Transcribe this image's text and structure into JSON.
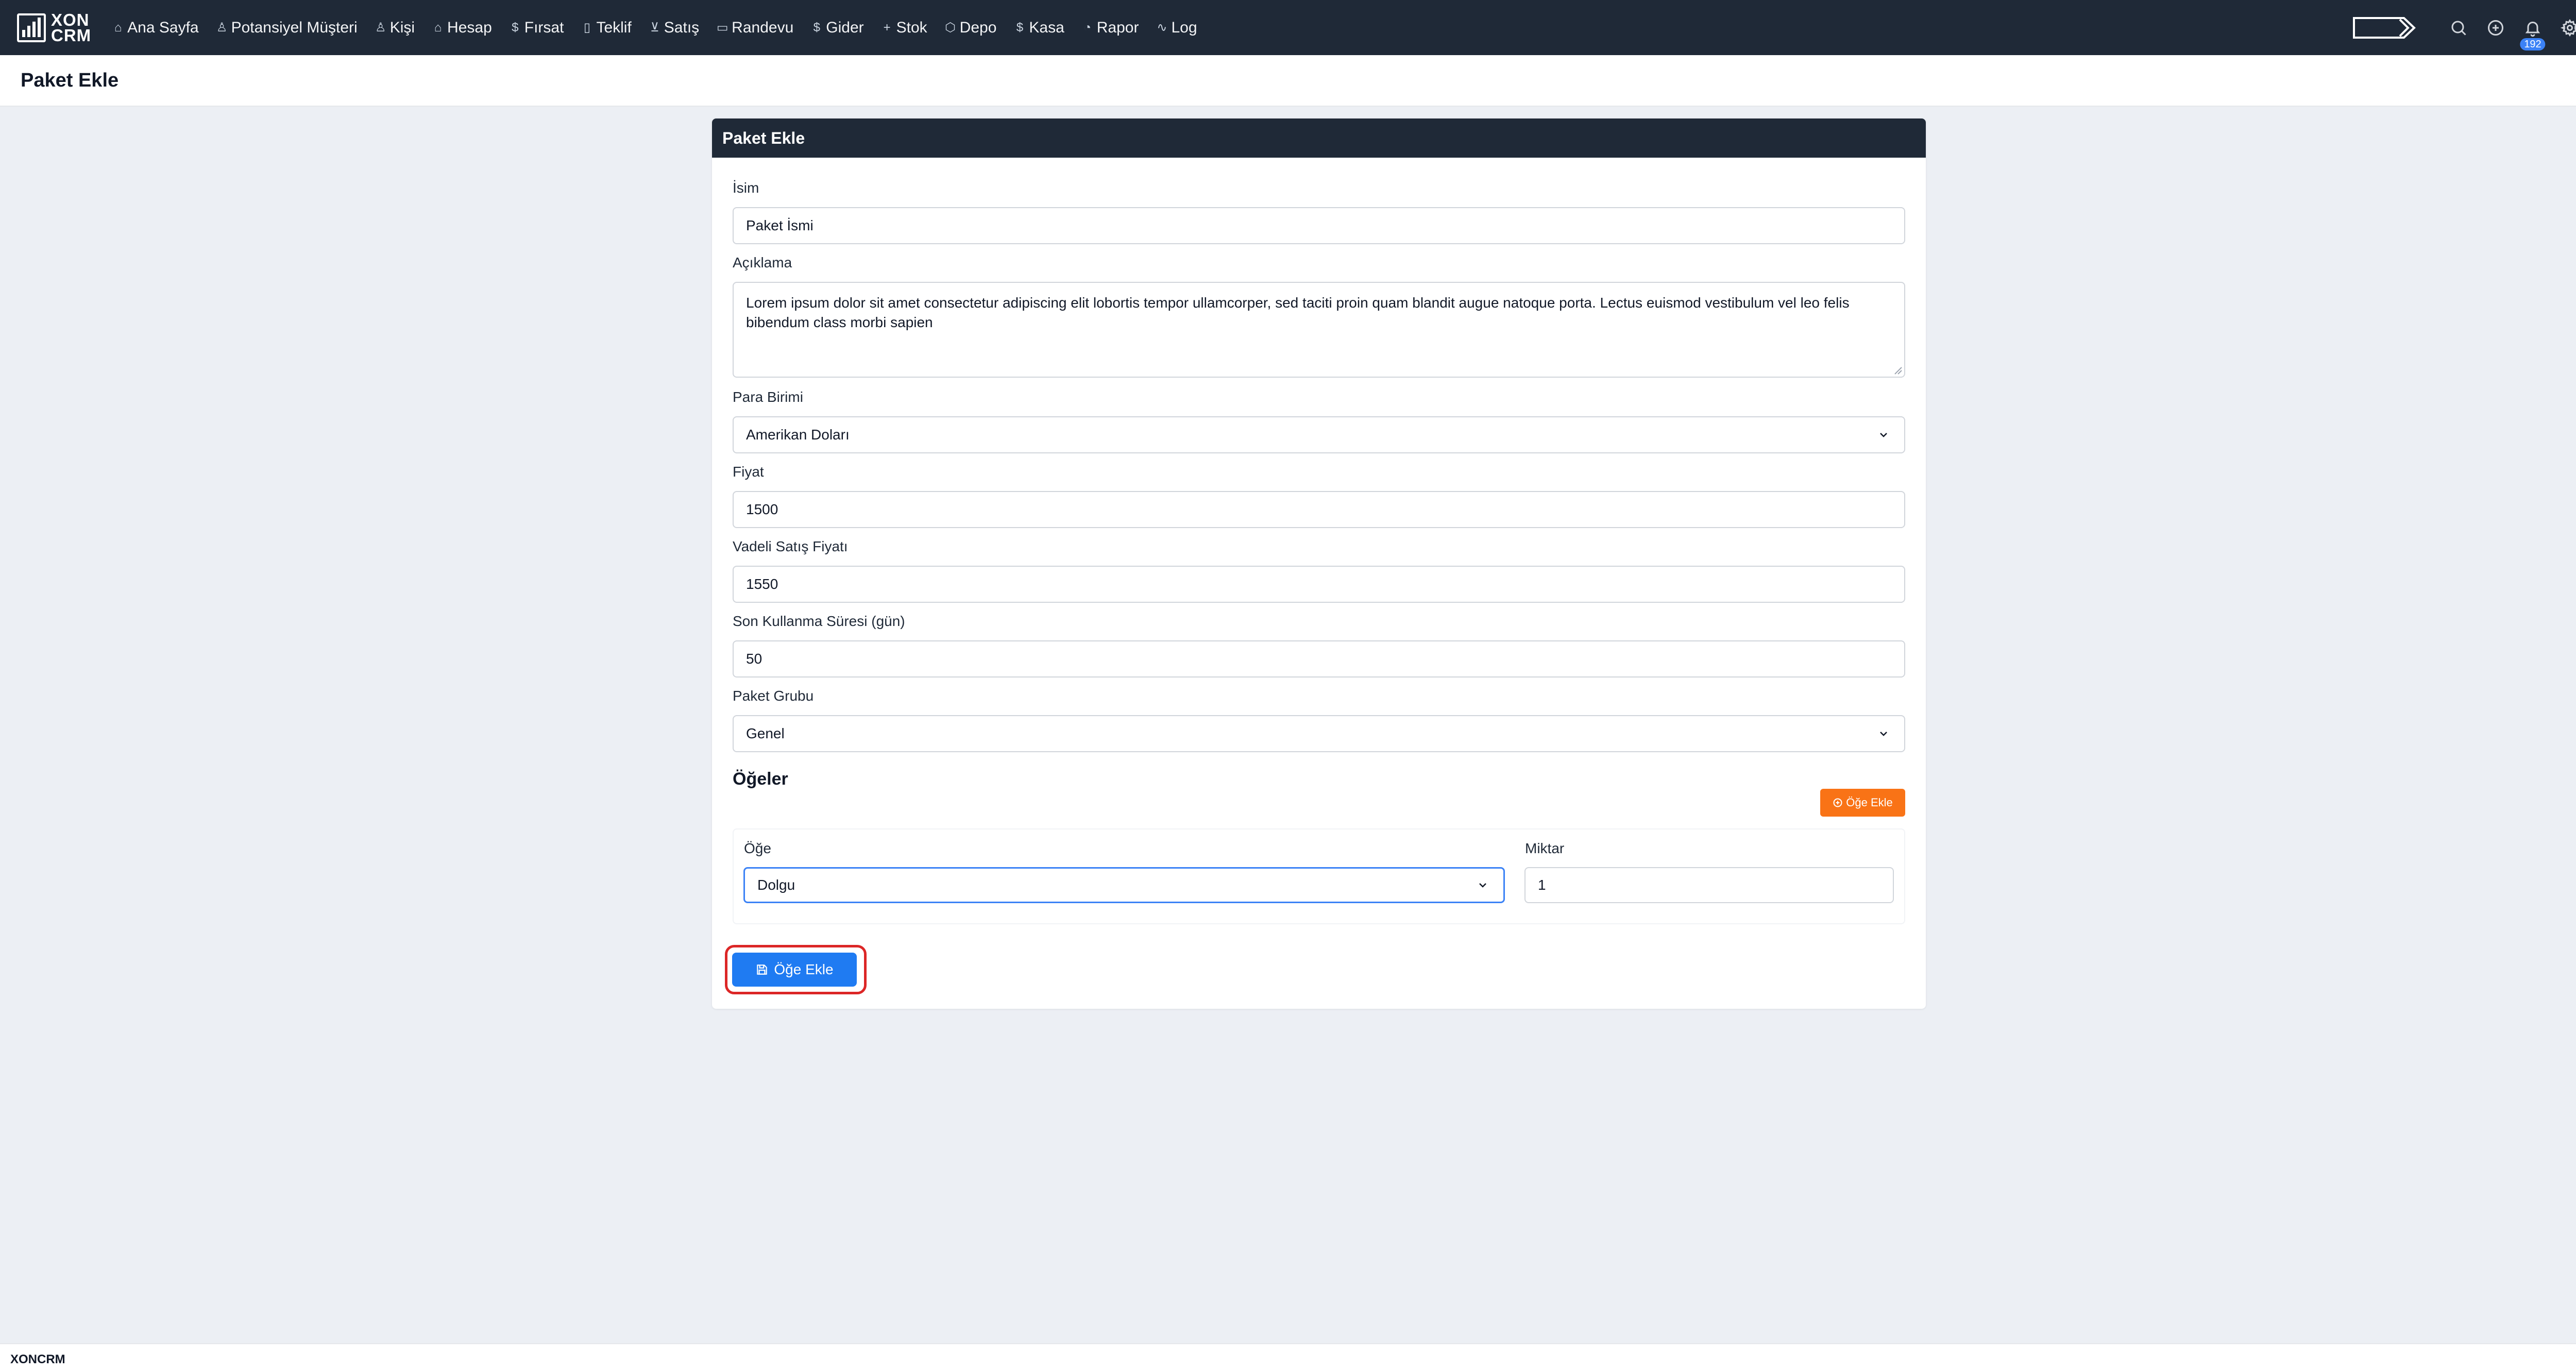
{
  "app": {
    "logo_line1": "XON",
    "logo_line2": "CRM"
  },
  "nav": {
    "items": [
      {
        "label": "Ana Sayfa",
        "icon": "home-icon",
        "glyph": "⌂"
      },
      {
        "label": "Potansiyel Müşteri",
        "icon": "user-icon",
        "glyph": "♙"
      },
      {
        "label": "Kişi",
        "icon": "users-icon",
        "glyph": "♙"
      },
      {
        "label": "Hesap",
        "icon": "home-icon",
        "glyph": "⌂"
      },
      {
        "label": "Fırsat",
        "icon": "dollar-icon",
        "glyph": "$"
      },
      {
        "label": "Teklif",
        "icon": "document-icon",
        "glyph": "▯"
      },
      {
        "label": "Satış",
        "icon": "cart-icon",
        "glyph": "⊻"
      },
      {
        "label": "Randevu",
        "icon": "calendar-icon",
        "glyph": "▭"
      },
      {
        "label": "Gider",
        "icon": "dollar-icon",
        "glyph": "$"
      },
      {
        "label": "Stok",
        "icon": "plus-icon",
        "glyph": "+"
      },
      {
        "label": "Depo",
        "icon": "cube-icon",
        "glyph": "⬡"
      },
      {
        "label": "Kasa",
        "icon": "dollar-icon",
        "glyph": "$"
      },
      {
        "label": "Rapor",
        "icon": "pie-chart-icon",
        "glyph": "◔"
      },
      {
        "label": "Log",
        "icon": "activity-icon",
        "glyph": "∿"
      }
    ],
    "notifications_count": "192"
  },
  "page": {
    "title": "Paket Ekle"
  },
  "form": {
    "card_title": "Paket Ekle",
    "name_label": "İsim",
    "name_value": "Paket İsmi",
    "description_label": "Açıklama",
    "description_value": "Lorem ipsum dolor sit amet consectetur adipiscing elit lobortis tempor ullamcorper, sed taciti proin quam blandit augue natoque porta. Lectus euismod vestibulum vel leo felis bibendum class morbi sapien",
    "currency_label": "Para Birimi",
    "currency_value": "Amerikan Doları",
    "price_label": "Fiyat",
    "price_value": "1500",
    "term_price_label": "Vadeli Satış Fiyatı",
    "term_price_value": "1550",
    "expiry_label": "Son Kullanma Süresi (gün)",
    "expiry_value": "50",
    "group_label": "Paket Grubu",
    "group_value": "Genel",
    "items_title": "Öğeler",
    "add_item_small_label": "Öğe Ekle",
    "item_label": "Öğe",
    "item_value": "Dolgu",
    "quantity_label": "Miktar",
    "quantity_value": "1",
    "submit_label": "Öğe Ekle"
  },
  "footer": {
    "text": "XONCRM"
  },
  "colors": {
    "nav_bg": "#1f2937",
    "primary": "#1f7bf2",
    "orange": "#f97316",
    "highlight": "#dc2626"
  }
}
